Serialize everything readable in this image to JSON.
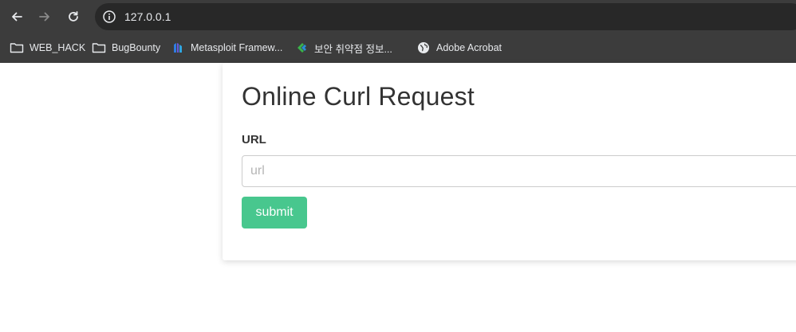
{
  "browser": {
    "url": "127.0.0.1",
    "bookmarks": [
      {
        "label": "WEB_HACK",
        "icon": "folder-icon"
      },
      {
        "label": "BugBounty",
        "icon": "folder-icon"
      },
      {
        "label": "Metasploit Framew...",
        "icon": "metasploit-icon"
      },
      {
        "label": "보안 취약점 정보...",
        "icon": "security-site-icon"
      },
      {
        "label": "Adobe Acrobat",
        "icon": "globe-icon"
      }
    ]
  },
  "page": {
    "title": "Online Curl Request",
    "url_label": "URL",
    "url_placeholder": "url",
    "url_value": "",
    "submit_label": "submit"
  },
  "colors": {
    "chrome_bg": "#3c3c3c",
    "omnibox_bg": "#282828",
    "submit_bg": "#48c78e"
  }
}
